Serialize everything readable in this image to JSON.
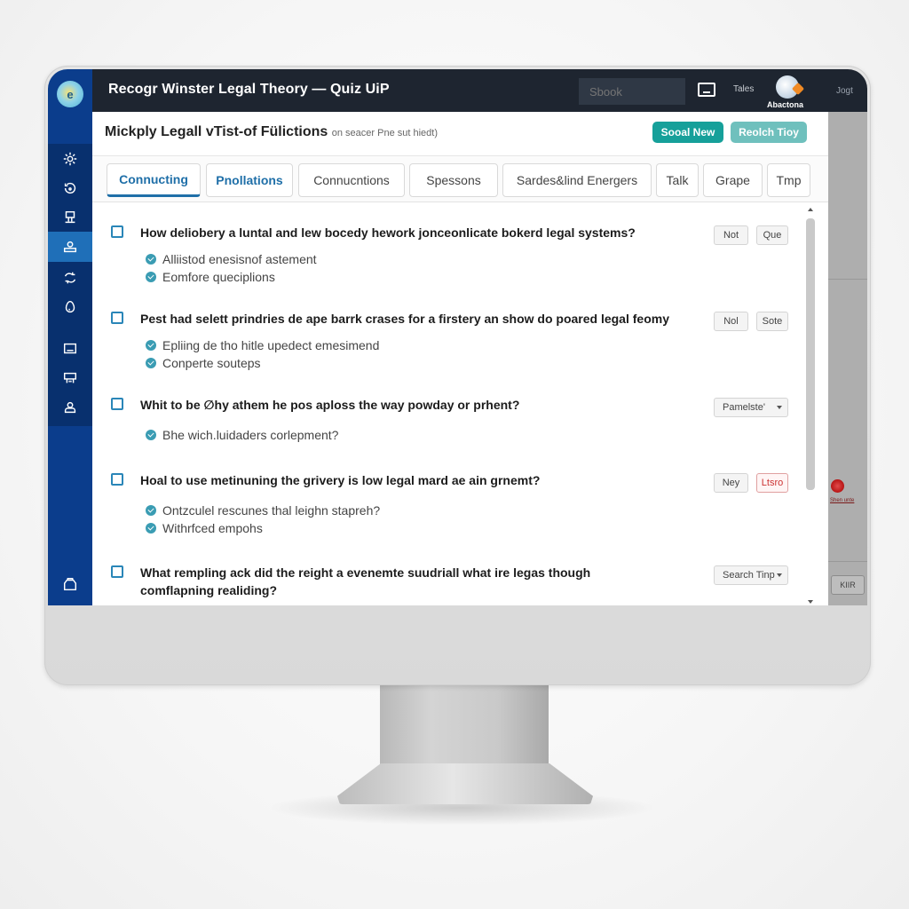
{
  "app": {
    "title": "Recogr Winster Legal Theory — Quiz UiP",
    "logo_glyph": "e",
    "search_placeholder": "Sbook",
    "tabs_link": "Tales",
    "avatar_label": "Abactona",
    "jobs_link": "Jogt"
  },
  "sidebar": {
    "items": [
      {
        "icon": "gear-icon",
        "active": false
      },
      {
        "icon": "refresh-icon",
        "active": false
      },
      {
        "icon": "stamp-icon",
        "active": false
      },
      {
        "icon": "user-badge-icon",
        "active": true
      },
      {
        "icon": "cycle-icon",
        "active": false
      },
      {
        "icon": "egg-icon",
        "active": false
      },
      {
        "icon": "monitor-icon",
        "active": false
      },
      {
        "icon": "printer-icon",
        "active": false
      },
      {
        "icon": "user-icon",
        "active": false
      }
    ],
    "bottom_icon": "bag-icon"
  },
  "header": {
    "title": "Mickply Legall vTist-of Fülictions",
    "subtitle": "on seacer Pne sut hiedt)",
    "primary_button": "Sooal New",
    "secondary_button": "Reolch Tioy"
  },
  "tabs": [
    {
      "label": "Connucting",
      "state": "active"
    },
    {
      "label": "Pnollations",
      "state": "accent"
    },
    {
      "label": "Connucntions",
      "state": "normal"
    },
    {
      "label": "Spessons",
      "state": "normal"
    },
    {
      "label": "Sardes&lind Energers",
      "state": "normal"
    },
    {
      "label": "Talk",
      "state": "normal"
    },
    {
      "label": "Grape",
      "state": "normal"
    },
    {
      "label": "Tmp",
      "state": "normal"
    }
  ],
  "questions": [
    {
      "text": "How deliobery a luntal and lew bocedy hework jonceonlicate bokerd legal systems?",
      "answers": [
        "Alliistod enesisnof astement",
        "Eomfore queciplions"
      ],
      "actions": [
        {
          "label": "Not",
          "type": "button"
        },
        {
          "label": "Que",
          "type": "button"
        }
      ]
    },
    {
      "text": "Pest had selett prindries de ape barrk crases for a firstery an show do poared legal feomy",
      "answers": [
        "Epliing de tho hitle upedect emesimend",
        "Conperte souteps"
      ],
      "actions": [
        {
          "label": "Nol",
          "type": "button"
        },
        {
          "label": "Sote",
          "type": "button"
        }
      ]
    },
    {
      "text": "Whit to be ∅hy athem he pos aploss the way powday or prhent?",
      "answers": [
        "Bhe wich.luidaders corlepment?"
      ],
      "actions": [
        {
          "label": "Pamelste'",
          "type": "select"
        }
      ]
    },
    {
      "text": "Hoal to use metinuning the grivery is low legal mard ae ain grnemt?",
      "answers": [
        "Ontzculel rescunes thal leighn stapreh?",
        "Withrfced empohs"
      ],
      "actions": [
        {
          "label": "Ney",
          "type": "button"
        },
        {
          "label": "Ltsro",
          "type": "danger"
        }
      ]
    },
    {
      "text": "What rempling ack did the reight a evenemte suudriall what ire legas though comflapning realiding?",
      "answers": [],
      "actions": [
        {
          "label": "Search Tinp",
          "type": "select"
        }
      ]
    }
  ],
  "right_panel": {
    "tiny_link": "Shen unte",
    "button": "KIIR"
  },
  "colors": {
    "sidebar": "#0b3d8c",
    "topbar": "#1e2530",
    "accent_teal": "#16a09a",
    "accent_teal_light": "#6fc0bd",
    "tab_accent": "#1f6fa8",
    "danger": "#cc3333"
  }
}
